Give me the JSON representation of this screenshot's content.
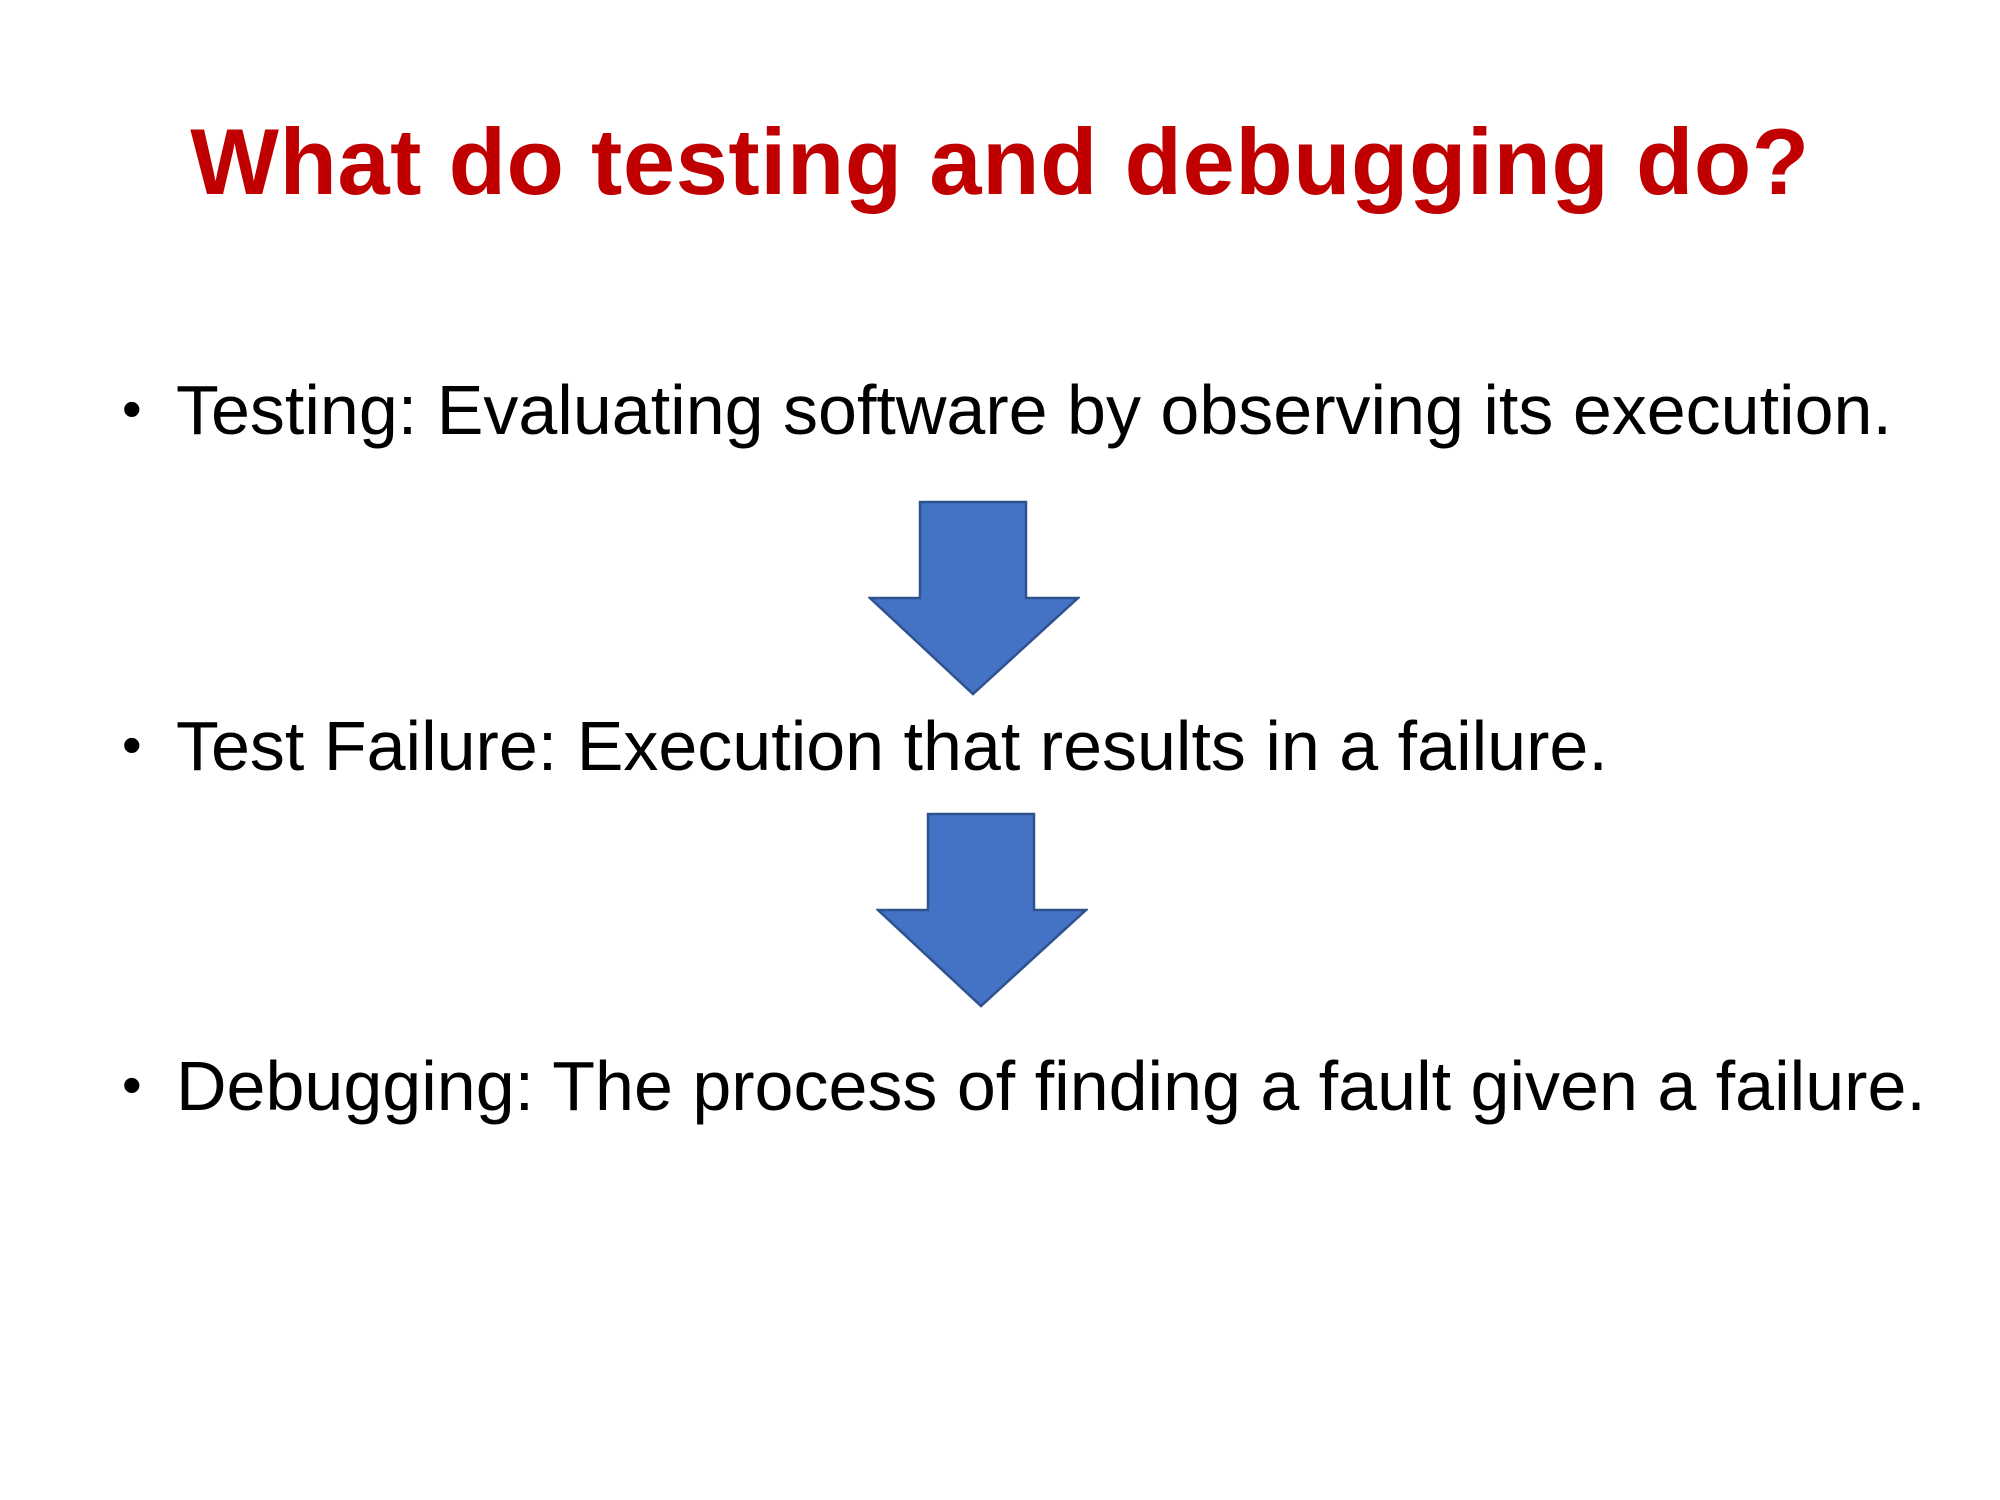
{
  "slide": {
    "title": "What do testing and debugging do?",
    "bullets": [
      {
        "symbol": "•",
        "text": "Testing: Evaluating software by observing its execution."
      },
      {
        "symbol": "•",
        "text": "Test Failure: Execution that results in a failure."
      },
      {
        "symbol": "•",
        "text": "Debugging: The process of finding a fault given a failure."
      }
    ],
    "arrows": [
      {
        "icon": "down-arrow-icon",
        "color": "#4472c4",
        "border": "#2f528f"
      },
      {
        "icon": "down-arrow-icon",
        "color": "#4472c4",
        "border": "#2f528f"
      }
    ],
    "colors": {
      "title": "#c00000",
      "text": "#000000",
      "background": "#ffffff"
    }
  }
}
